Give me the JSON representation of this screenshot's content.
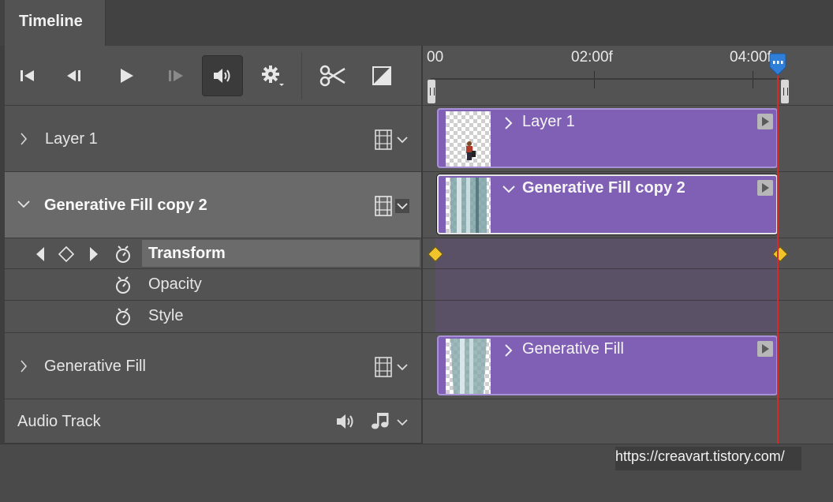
{
  "panel": {
    "tab_title": "Timeline"
  },
  "toolbar": {
    "buttons": [
      {
        "name": "go-to-first-frame",
        "icon": "first-frame-icon"
      },
      {
        "name": "previous-frame",
        "icon": "previous-frame-icon"
      },
      {
        "name": "play",
        "icon": "play-icon"
      },
      {
        "name": "next-frame",
        "icon": "next-frame-icon"
      },
      {
        "name": "audio",
        "icon": "speaker-icon",
        "active": true
      },
      {
        "name": "settings",
        "icon": "gear-icon"
      },
      {
        "name": "split-at-playhead",
        "icon": "scissors-icon"
      },
      {
        "name": "transition",
        "icon": "transition-icon"
      }
    ]
  },
  "ruler": {
    "labels": [
      "00",
      "02:00f",
      "04:00f"
    ]
  },
  "layers": [
    {
      "name": "Layer 1",
      "expanded": false
    },
    {
      "name": "Generative Fill copy 2",
      "expanded": true,
      "selected": true
    },
    {
      "name": "Generative Fill",
      "expanded": false
    }
  ],
  "properties": {
    "transform": "Transform",
    "opacity": "Opacity",
    "style": "Style"
  },
  "audio_track": {
    "label": "Audio Track"
  },
  "clips": [
    {
      "name": "Layer 1"
    },
    {
      "name": "Generative Fill copy 2"
    },
    {
      "name": "Generative Fill"
    }
  ],
  "watermark": "https://creavart.tistory.com/",
  "colors": {
    "clip": "#8060b5",
    "playhead": "#d62a2a",
    "keyframe": "#f0c42a",
    "panel_bg": "#535353"
  }
}
